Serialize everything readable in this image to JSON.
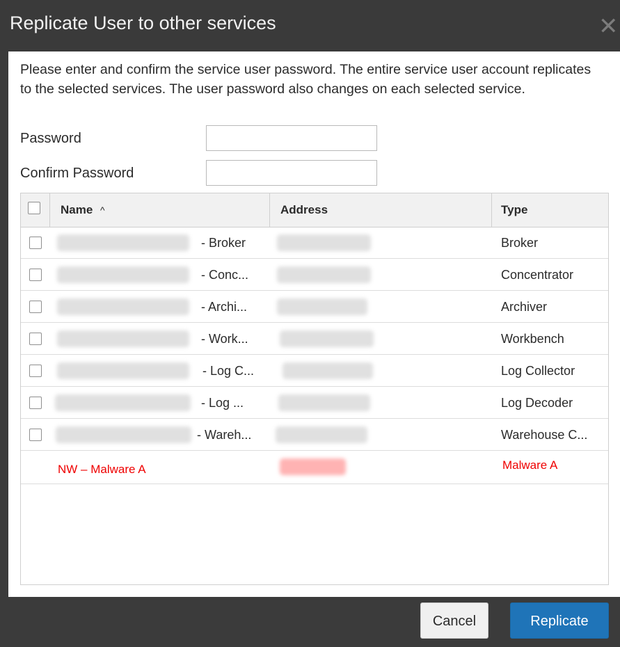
{
  "dialog": {
    "title": "Replicate User to other services",
    "close_icon": "close-icon",
    "instructions": "Please enter and confirm the service user password. The entire service user account replicates to the selected services. The user password also changes on each selected service."
  },
  "form": {
    "password_label": "Password",
    "password_value": "",
    "confirm_label": "Confirm Password",
    "confirm_value": ""
  },
  "table": {
    "columns": {
      "name": "Name",
      "sort_indicator": "^",
      "address": "Address",
      "type": "Type"
    },
    "rows": [
      {
        "name_suffix": "- Broker",
        "type": "Broker"
      },
      {
        "name_suffix": "- Conc...",
        "type": "Concentrator"
      },
      {
        "name_suffix": "- Archi...",
        "type": "Archiver"
      },
      {
        "name_suffix": "- Work...",
        "type": "Workbench"
      },
      {
        "name_suffix": "- Log C...",
        "type": "Log Collector"
      },
      {
        "name_suffix": "- Log ...",
        "type": "Log Decoder"
      },
      {
        "name_suffix": "- Wareh...",
        "type": "Warehouse C..."
      }
    ],
    "highlight_row": {
      "name": "NW – Malware A",
      "type": "Malware A"
    }
  },
  "footer": {
    "cancel_label": "Cancel",
    "replicate_label": "Replicate"
  },
  "colors": {
    "titlebar": "#3a3a3a",
    "primary_button": "#1f74b8",
    "highlight_text": "#ef0000"
  }
}
